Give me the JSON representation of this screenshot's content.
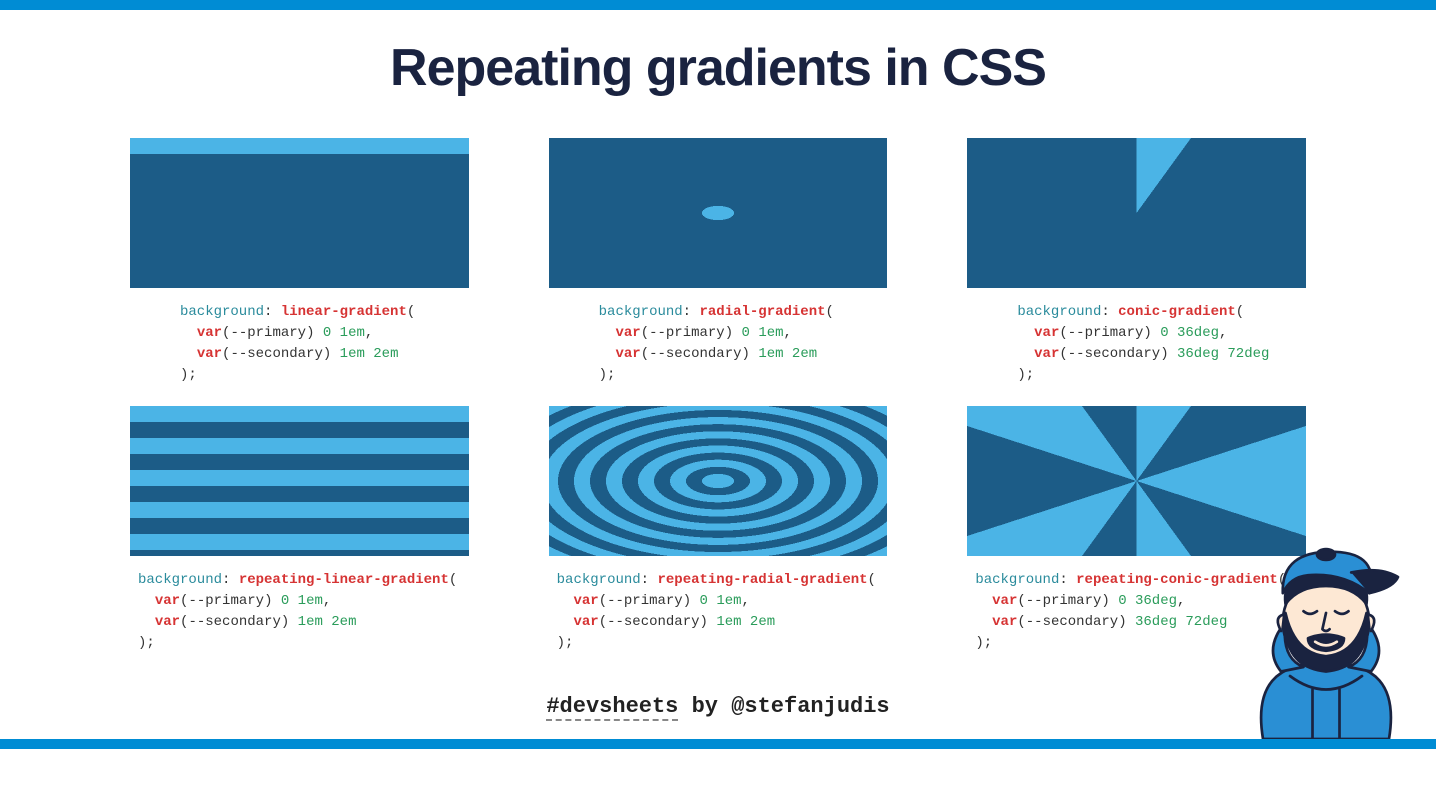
{
  "title": "Repeating gradients in CSS",
  "footer": {
    "tag": "#devsheets",
    "by": " by @stefanjudis"
  },
  "code": {
    "bg": "background",
    "var": "var",
    "prim": "--primary",
    "sec": "--secondary",
    "linear": {
      "func": "linear-gradient",
      "p": "0 1em",
      "s": "1em 2em"
    },
    "radial": {
      "func": "radial-gradient",
      "p": "0 1em",
      "s": "1em 2em"
    },
    "conic": {
      "func": "conic-gradient",
      "p": "0 36deg",
      "s": "36deg 72deg"
    },
    "rlinear": {
      "func": "repeating-linear-gradient",
      "p": "0 1em",
      "s": "1em 2em"
    },
    "rradial": {
      "func": "repeating-radial-gradient",
      "p": "0 1em",
      "s": "1em 2em"
    },
    "rconic": {
      "func": "repeating-conic-gradient",
      "p": "0 36deg",
      "s": "36deg 72deg"
    }
  }
}
